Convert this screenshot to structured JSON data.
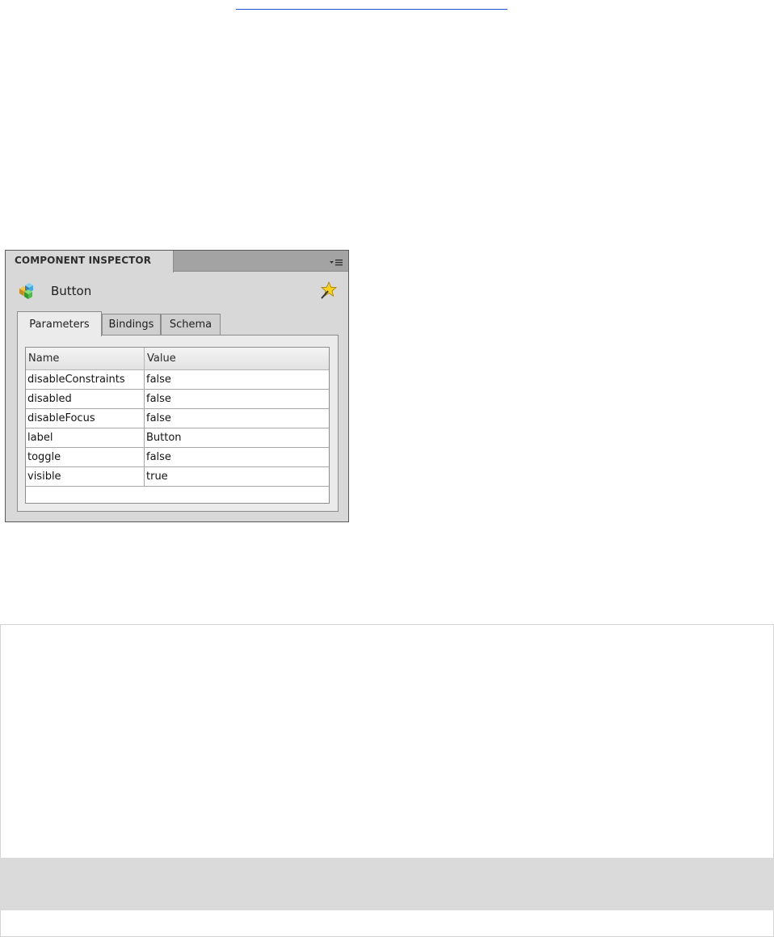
{
  "panel": {
    "title": "COMPONENT INSPECTOR",
    "menu_icon": "panel-menu-icon",
    "component": {
      "icon": "component-icon",
      "name": "Button",
      "wizard_icon": "behavior-wizard-icon"
    },
    "tabs": [
      {
        "label": "Parameters",
        "active": true
      },
      {
        "label": "Bindings",
        "active": false
      },
      {
        "label": "Schema",
        "active": false
      }
    ],
    "grid": {
      "columns": [
        "Name",
        "Value"
      ],
      "rows": [
        {
          "name": "disableConstraints",
          "value": "false"
        },
        {
          "name": "disabled",
          "value": "false"
        },
        {
          "name": "disableFocus",
          "value": "false"
        },
        {
          "name": "label",
          "value": "Button"
        },
        {
          "name": "toggle",
          "value": "false"
        },
        {
          "name": "visible",
          "value": "true"
        }
      ]
    }
  },
  "colors": {
    "panel_bg": "#d8d8d8",
    "header_bar": "#a3a3a3",
    "tab_body_bg": "#ebebeb",
    "link_underline": "#1a53d9",
    "bottom_band": "#dadada"
  }
}
